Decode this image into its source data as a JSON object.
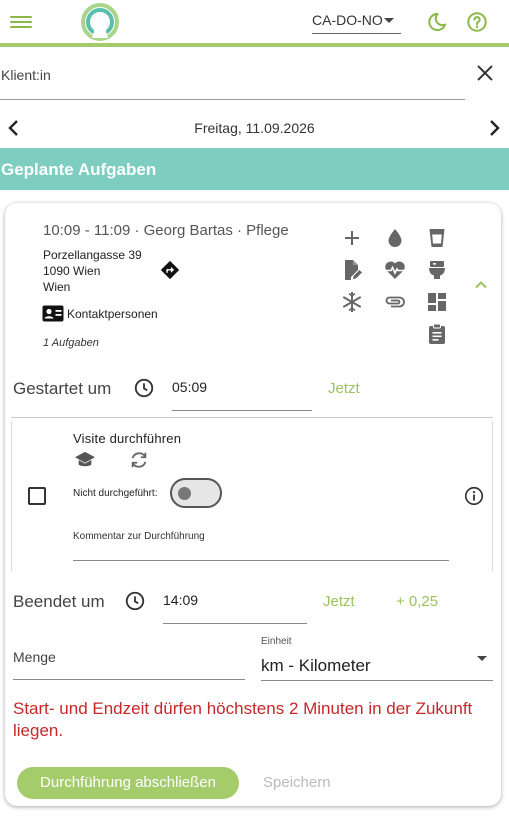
{
  "header": {
    "menu_icon": "hamburger-menu-icon",
    "logo_icon": "app-logo-ring",
    "org_select_value": "CA-DO-NO",
    "theme_icon": "dark-mode-moon-icon",
    "help_icon": "help-question-icon",
    "accent_color": "#a4cc6b"
  },
  "client": {
    "placeholder": "Klient:in",
    "value": "",
    "clear_icon": "close-icon"
  },
  "date_nav": {
    "date": "Freitag, 11.09.2026",
    "prev_icon": "chevron-left-icon",
    "next_icon": "chevron-right-icon"
  },
  "section": {
    "title": "Geplante Aufgaben",
    "color": "#7ecdc1"
  },
  "appointment": {
    "title": "10:09 - 11:09 · Georg Bartas · Pflege",
    "address_lines": [
      "Porzellangasse 39",
      "1090 Wien",
      "Wien"
    ],
    "contacts_label": "Kontaktpersonen",
    "task_count": "1 Aufgaben",
    "action_icons": [
      "add-icon",
      "water-drop-icon",
      "cup-icon",
      "document-edit-icon",
      "heart-pulse-icon",
      "toilet-icon",
      "snowflake-icon",
      "attachment-icon",
      "dashboard-icon",
      "clipboard-icon"
    ]
  },
  "start": {
    "label": "Gestartet um",
    "time": "05:09",
    "now_label": "Jetzt"
  },
  "task": {
    "name": "Visite durchführen",
    "not_done_label": "Nicht durchgeführt:",
    "not_done": false,
    "comment_placeholder": "Kommentar zur Durchführung",
    "comment_value": ""
  },
  "end": {
    "label": "Beendet um",
    "time": "14:09",
    "now_label": "Jetzt",
    "increment_label": "+ 0,25"
  },
  "amount": {
    "menge_placeholder": "Menge",
    "menge_value": "",
    "einheit_label": "Einheit",
    "einheit_value": "km - Kilometer"
  },
  "error_message": "Start- und Endzeit dürfen höchstens 2 Minuten in der Zukunft liegen.",
  "buttons": {
    "finish_label": "Durchführung abschließen",
    "save_label": "Speichern"
  },
  "colors": {
    "accent_green": "#9ac45d",
    "error_red": "#c62828",
    "icon_gray": "#666666"
  }
}
